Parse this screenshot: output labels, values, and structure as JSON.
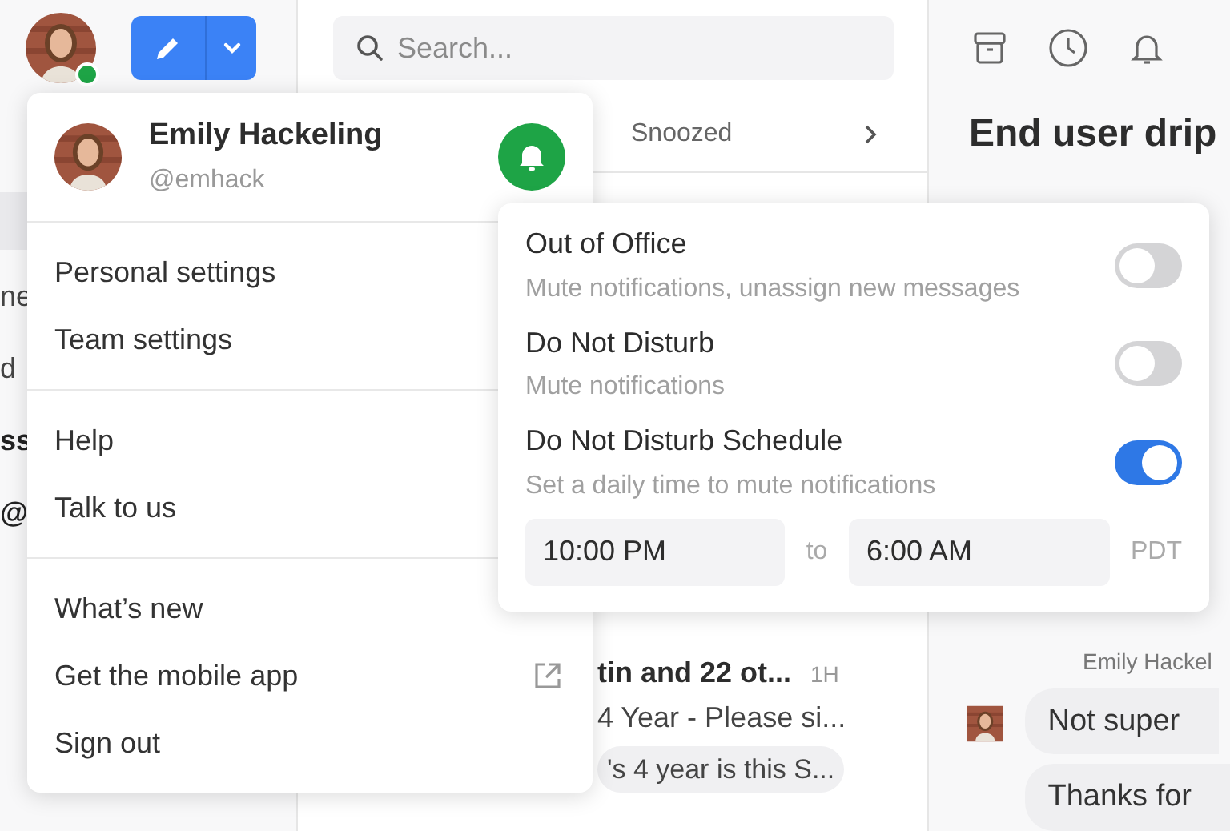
{
  "topbar": {
    "online": true,
    "search": {
      "placeholder": "Search..."
    }
  },
  "sidebar": {
    "fragments": [
      {
        "text": "ne",
        "bold": false
      },
      {
        "text": "d",
        "bold": false
      },
      {
        "text": "ss",
        "bold": true
      },
      {
        "text": "@",
        "bold": true
      }
    ]
  },
  "conversation_list": {
    "header": "Snoozed",
    "item": {
      "title": "tin and 22 ot...",
      "time": "1H",
      "subject": "4 Year - Please si...",
      "preview": "'s 4 year is this S..."
    }
  },
  "conversation": {
    "title": "End user drip",
    "sender": "Emily Hackel",
    "bubbles": [
      "Not super",
      "Thanks for"
    ]
  },
  "account_menu": {
    "name": "Emily Hackeling",
    "handle": "@emhack",
    "notifications_on": true,
    "groups": [
      [
        {
          "label": "Personal settings"
        },
        {
          "label": "Team settings"
        }
      ],
      [
        {
          "label": "Help"
        },
        {
          "label": "Talk to us"
        }
      ],
      [
        {
          "label": "What’s new"
        },
        {
          "label": "Get the mobile app",
          "external": true
        },
        {
          "label": "Sign out"
        }
      ]
    ]
  },
  "notification_menu": {
    "options": [
      {
        "title": "Out of Office",
        "description": "Mute notifications, unassign new messages",
        "on": false
      },
      {
        "title": "Do Not Disturb",
        "description": "Mute notifications",
        "on": false
      },
      {
        "title": "Do Not Disturb Schedule",
        "description": "Set a daily time to mute notifications",
        "on": true
      }
    ],
    "schedule": {
      "start": "10:00 PM",
      "separator": "to",
      "end": "6:00 AM",
      "timezone": "PDT"
    }
  }
}
